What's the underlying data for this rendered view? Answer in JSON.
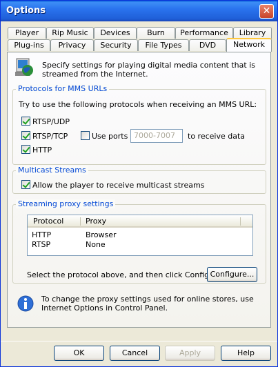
{
  "window": {
    "title": "Options"
  },
  "tabs": {
    "row1": [
      "Player",
      "Rip Music",
      "Devices",
      "Burn",
      "Performance",
      "Library"
    ],
    "row2": [
      "Plug-ins",
      "Privacy",
      "Security",
      "File Types",
      "DVD",
      "Network"
    ],
    "active": "Network"
  },
  "intro": "Specify settings for playing digital media content that is streamed from the Internet.",
  "protocols": {
    "title": "Protocols for MMS URLs",
    "instruction": "Try to use the following protocols when receiving an MMS URL:",
    "rtsp_udp": {
      "label": "RTSP/UDP",
      "checked": true
    },
    "rtsp_tcp": {
      "label": "RTSP/TCP",
      "checked": true
    },
    "use_ports": {
      "label": "Use ports",
      "checked": false
    },
    "ports_value": "7000-7007",
    "receive_text": "to receive data",
    "http": {
      "label": "HTTP",
      "checked": true
    }
  },
  "multicast": {
    "title": "Multicast Streams",
    "allow": {
      "label": "Allow the player to receive multicast streams",
      "checked": true
    }
  },
  "proxy": {
    "title": "Streaming proxy settings",
    "columns": [
      "Protocol",
      "Proxy"
    ],
    "rows": [
      {
        "protocol": "HTTP",
        "proxy": "Browser"
      },
      {
        "protocol": "RTSP",
        "proxy": "None"
      }
    ],
    "hint": "Select the protocol above, and then click Configure.",
    "configure_label": "Configure..."
  },
  "info_text": "To change the proxy settings used for online stores, use Internet Options in Control Panel.",
  "buttons": {
    "ok": "OK",
    "cancel": "Cancel",
    "apply": "Apply",
    "help": "Help"
  },
  "colors": {
    "titlebar": "#1f5fd8",
    "group_title": "#0046d5",
    "accent_tab": "#ffc83c"
  }
}
